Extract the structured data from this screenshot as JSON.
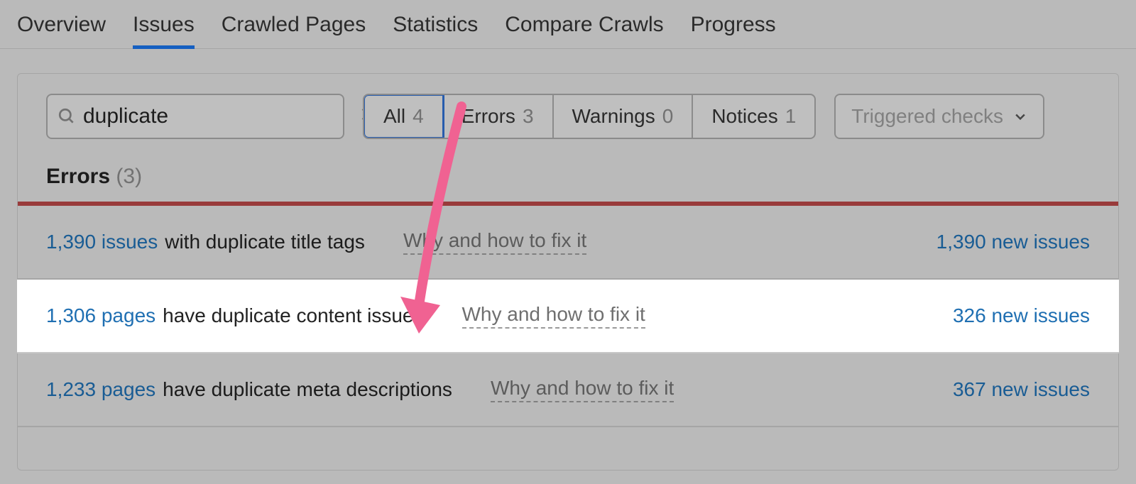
{
  "tabs": {
    "overview": "Overview",
    "issues": "Issues",
    "crawled": "Crawled Pages",
    "statistics": "Statistics",
    "compare": "Compare Crawls",
    "progress": "Progress"
  },
  "search": {
    "value": "duplicate"
  },
  "filters": {
    "all": {
      "label": "All",
      "count": "4"
    },
    "errors": {
      "label": "Errors",
      "count": "3"
    },
    "warnings": {
      "label": "Warnings",
      "count": "0"
    },
    "notices": {
      "label": "Notices",
      "count": "1"
    }
  },
  "dropdown": {
    "label": "Triggered checks"
  },
  "section": {
    "label": "Errors",
    "count": "(3)"
  },
  "rows": [
    {
      "link": "1,390 issues",
      "desc": "with duplicate title tags",
      "fix": "Why and how to fix it",
      "right": "1,390 new issues"
    },
    {
      "link": "1,306 pages",
      "desc": "have duplicate content issues",
      "fix": "Why and how to fix it",
      "right": "326 new issues"
    },
    {
      "link": "1,233 pages",
      "desc": "have duplicate meta descriptions",
      "fix": "Why and how to fix it",
      "right": "367 new issues"
    }
  ]
}
